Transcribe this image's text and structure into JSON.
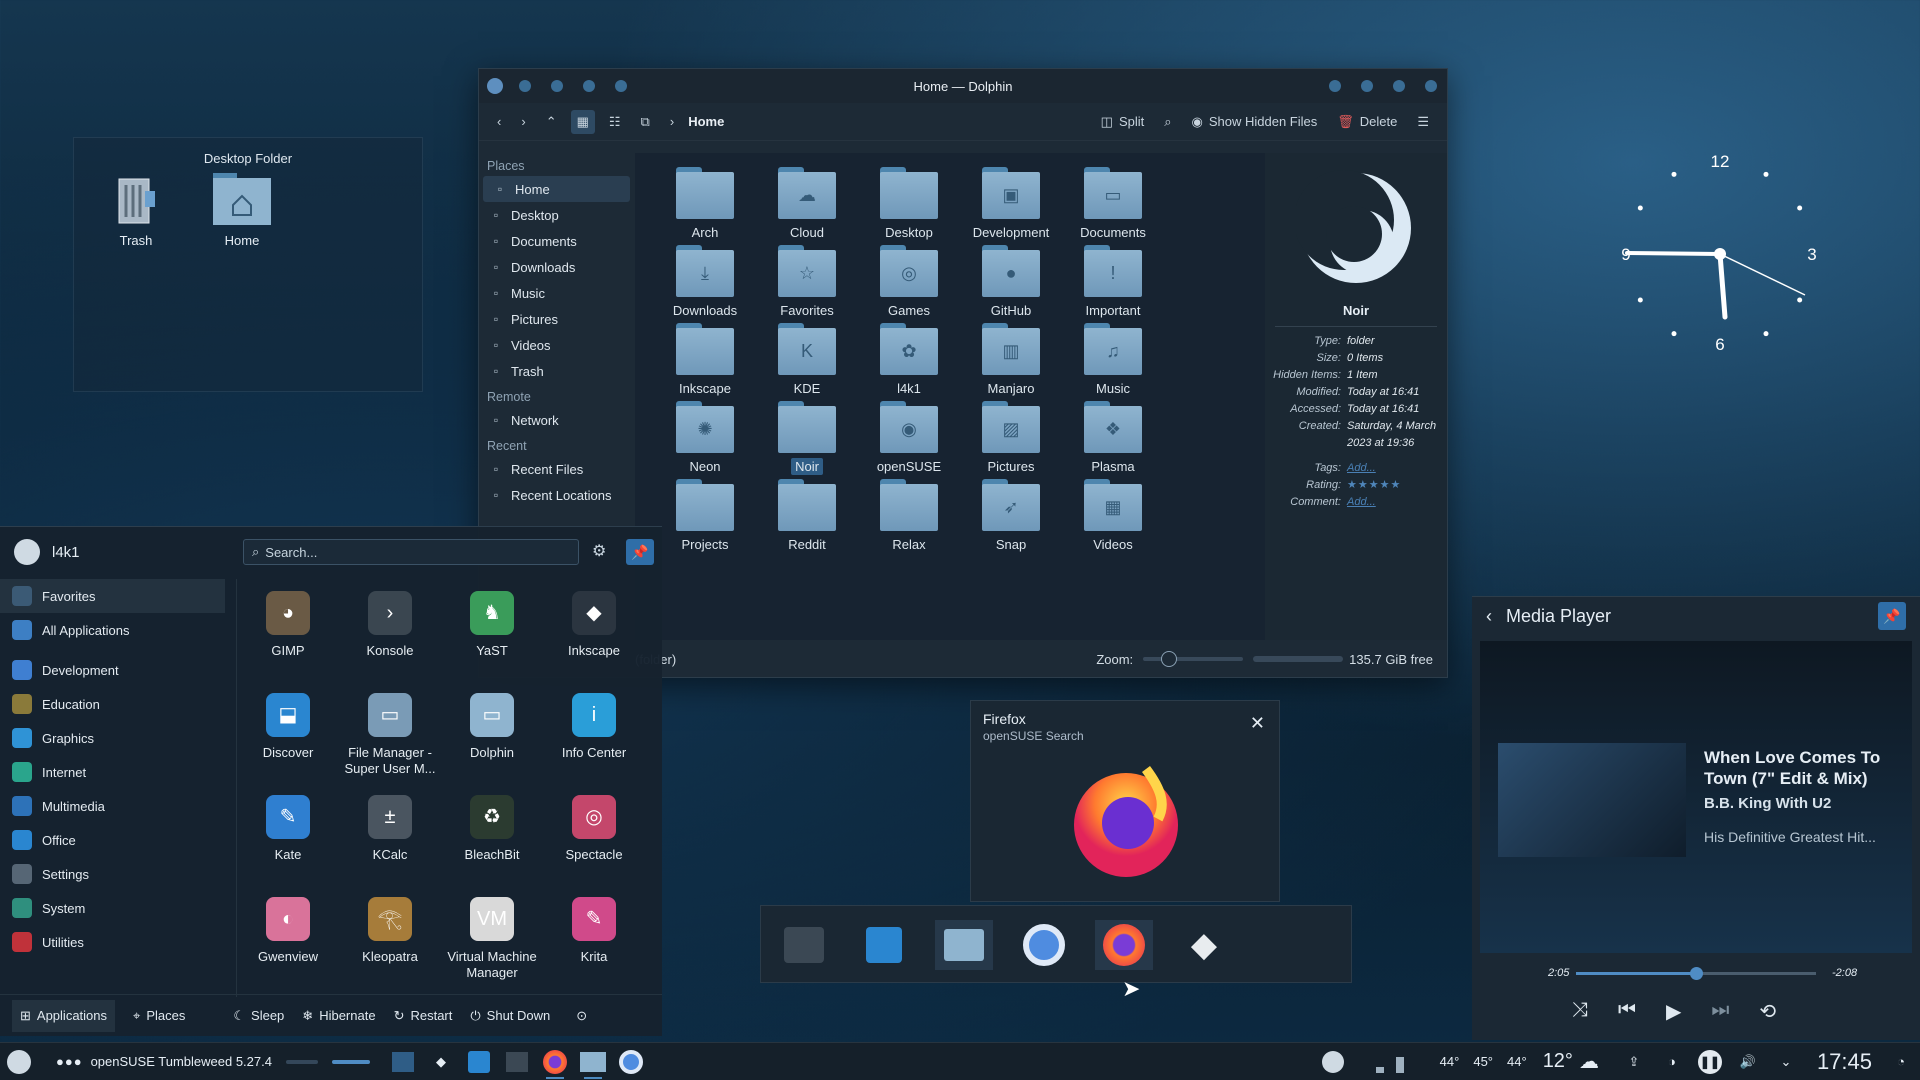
{
  "desktop_folder": {
    "title": "Desktop Folder",
    "items": [
      {
        "label": "Trash"
      },
      {
        "label": "Home"
      }
    ]
  },
  "dolphin": {
    "title": "Home — Dolphin",
    "breadcrumb": "Home",
    "toolbar": {
      "split": "Split",
      "show_hidden": "Show Hidden Files",
      "delete": "Delete"
    },
    "places_header": "Places",
    "places": [
      {
        "label": "Home",
        "icon": "home-icon"
      },
      {
        "label": "Desktop",
        "icon": "desktop-icon"
      },
      {
        "label": "Documents",
        "icon": "document-icon"
      },
      {
        "label": "Downloads",
        "icon": "download-icon"
      },
      {
        "label": "Music",
        "icon": "music-icon"
      },
      {
        "label": "Pictures",
        "icon": "picture-icon"
      },
      {
        "label": "Videos",
        "icon": "video-icon"
      },
      {
        "label": "Trash",
        "icon": "trash-icon"
      }
    ],
    "remote_header": "Remote",
    "remote": [
      {
        "label": "Network",
        "icon": "network-icon"
      }
    ],
    "recent_header": "Recent",
    "recent": [
      {
        "label": "Recent Files",
        "icon": "recent-files-icon"
      },
      {
        "label": "Recent Locations",
        "icon": "recent-locations-icon"
      }
    ],
    "folders": [
      {
        "label": "Arch",
        "glyph": ""
      },
      {
        "label": "Cloud",
        "glyph": "☁"
      },
      {
        "label": "Desktop",
        "glyph": ""
      },
      {
        "label": "Development",
        "glyph": "▣"
      },
      {
        "label": "Documents",
        "glyph": "▭"
      },
      {
        "label": "Downloads",
        "glyph": "⤓"
      },
      {
        "label": "Favorites",
        "glyph": "☆"
      },
      {
        "label": "Games",
        "glyph": "◎"
      },
      {
        "label": "GitHub",
        "glyph": "●"
      },
      {
        "label": "Important",
        "glyph": "!"
      },
      {
        "label": "Inkscape",
        "glyph": ""
      },
      {
        "label": "KDE",
        "glyph": "K"
      },
      {
        "label": "l4k1",
        "glyph": "✿"
      },
      {
        "label": "Manjaro",
        "glyph": "▥"
      },
      {
        "label": "Music",
        "glyph": "♫"
      },
      {
        "label": "Neon",
        "glyph": "✺"
      },
      {
        "label": "Noir",
        "glyph": ""
      },
      {
        "label": "openSUSE",
        "glyph": "◉"
      },
      {
        "label": "Pictures",
        "glyph": "▨"
      },
      {
        "label": "Plasma",
        "glyph": "❖"
      },
      {
        "label": "Projects",
        "glyph": ""
      },
      {
        "label": "Reddit",
        "glyph": ""
      },
      {
        "label": "Relax",
        "glyph": ""
      },
      {
        "label": "Snap",
        "glyph": "➶"
      },
      {
        "label": "Videos",
        "glyph": "▦"
      }
    ],
    "selected_folder": "Noir",
    "info": {
      "name": "Noir",
      "rows": [
        {
          "k": "Type:",
          "v": "folder"
        },
        {
          "k": "Size:",
          "v": "0 Items"
        },
        {
          "k": "Hidden Items:",
          "v": "1 Item"
        },
        {
          "k": "Modified:",
          "v": "Today at 16:41"
        },
        {
          "k": "Accessed:",
          "v": "Today at 16:41"
        },
        {
          "k": "Created:",
          "v": "Saturday, 4 March 2023 at 19:36"
        }
      ],
      "tags_label": "Tags:",
      "tags_value": "Add...",
      "rating_label": "Rating:",
      "rating_stars": "★★★★★",
      "comment_label": "Comment:",
      "comment_value": "Add..."
    },
    "status": {
      "selection": "(folder)",
      "zoom_label": "Zoom:",
      "free": "135.7 GiB free"
    }
  },
  "clock": {
    "numbers": [
      "12",
      "3",
      "6",
      "9"
    ]
  },
  "launcher": {
    "user": "l4k1",
    "search_placeholder": "Search...",
    "categories": [
      {
        "label": "Favorites",
        "color": "#3b5a75"
      },
      {
        "label": "All Applications",
        "color": "#3d7fc4"
      },
      {
        "label": "Development",
        "color": "#3f7fd1"
      },
      {
        "label": "Education",
        "color": "#8a7a3a"
      },
      {
        "label": "Graphics",
        "color": "#2f93d6"
      },
      {
        "label": "Internet",
        "color": "#2aa58c"
      },
      {
        "label": "Multimedia",
        "color": "#2d72b8"
      },
      {
        "label": "Office",
        "color": "#2a86d0"
      },
      {
        "label": "Settings",
        "color": "#566675"
      },
      {
        "label": "System",
        "color": "#2f8f7e"
      },
      {
        "label": "Utilities",
        "color": "#c0323a"
      }
    ],
    "apps": [
      {
        "label": "GIMP",
        "color": "#6a5a45",
        "glyph": "◕"
      },
      {
        "label": "Konsole",
        "color": "#3a4650",
        "glyph": "›"
      },
      {
        "label": "YaST",
        "color": "#3a9c5a",
        "glyph": "♞"
      },
      {
        "label": "Inkscape",
        "color": "#2b3540",
        "glyph": "◆"
      },
      {
        "label": "Discover",
        "color": "#2a86d0",
        "glyph": "⬓"
      },
      {
        "label": "File Manager - Super User M...",
        "color": "#7a9bb6",
        "glyph": "▭"
      },
      {
        "label": "Dolphin",
        "color": "#8fb4cf",
        "glyph": "▭"
      },
      {
        "label": "Info Center",
        "color": "#2a9ed8",
        "glyph": "i"
      },
      {
        "label": "Kate",
        "color": "#2f7fd0",
        "glyph": "✎"
      },
      {
        "label": "KCalc",
        "color": "#4a5560",
        "glyph": "±"
      },
      {
        "label": "BleachBit",
        "color": "#2b3b30",
        "glyph": "♻"
      },
      {
        "label": "Spectacle",
        "color": "#c4476b",
        "glyph": "◎"
      },
      {
        "label": "Gwenview",
        "color": "#d9739a",
        "glyph": "◐"
      },
      {
        "label": "Kleopatra",
        "color": "#a67c3a",
        "glyph": "𓂀"
      },
      {
        "label": "Virtual Machine Manager",
        "color": "#d9d9d9",
        "glyph": "VM"
      },
      {
        "label": "Krita",
        "color": "#d04a8a",
        "glyph": "✎"
      }
    ],
    "footer": {
      "applications": "Applications",
      "places": "Places",
      "sleep": "Sleep",
      "hibernate": "Hibernate",
      "restart": "Restart",
      "shutdown": "Shut Down"
    }
  },
  "firefox_tooltip": {
    "title": "Firefox",
    "subtitle": "openSUSE Search"
  },
  "media_player": {
    "title": "Media Player",
    "song": "When Love Comes To Town (7\" Edit & Mix)",
    "artist": "B.B. King With U2",
    "album": "His Definitive Greatest Hit...",
    "elapsed": "2:05",
    "remaining": "-2:08",
    "progress": 0.5
  },
  "taskbar": {
    "task_label": "openSUSE Tumbleweed 5.27.4",
    "temps": [
      "44°",
      "45°",
      "44°"
    ],
    "weather": "12°",
    "time": "17:45"
  }
}
